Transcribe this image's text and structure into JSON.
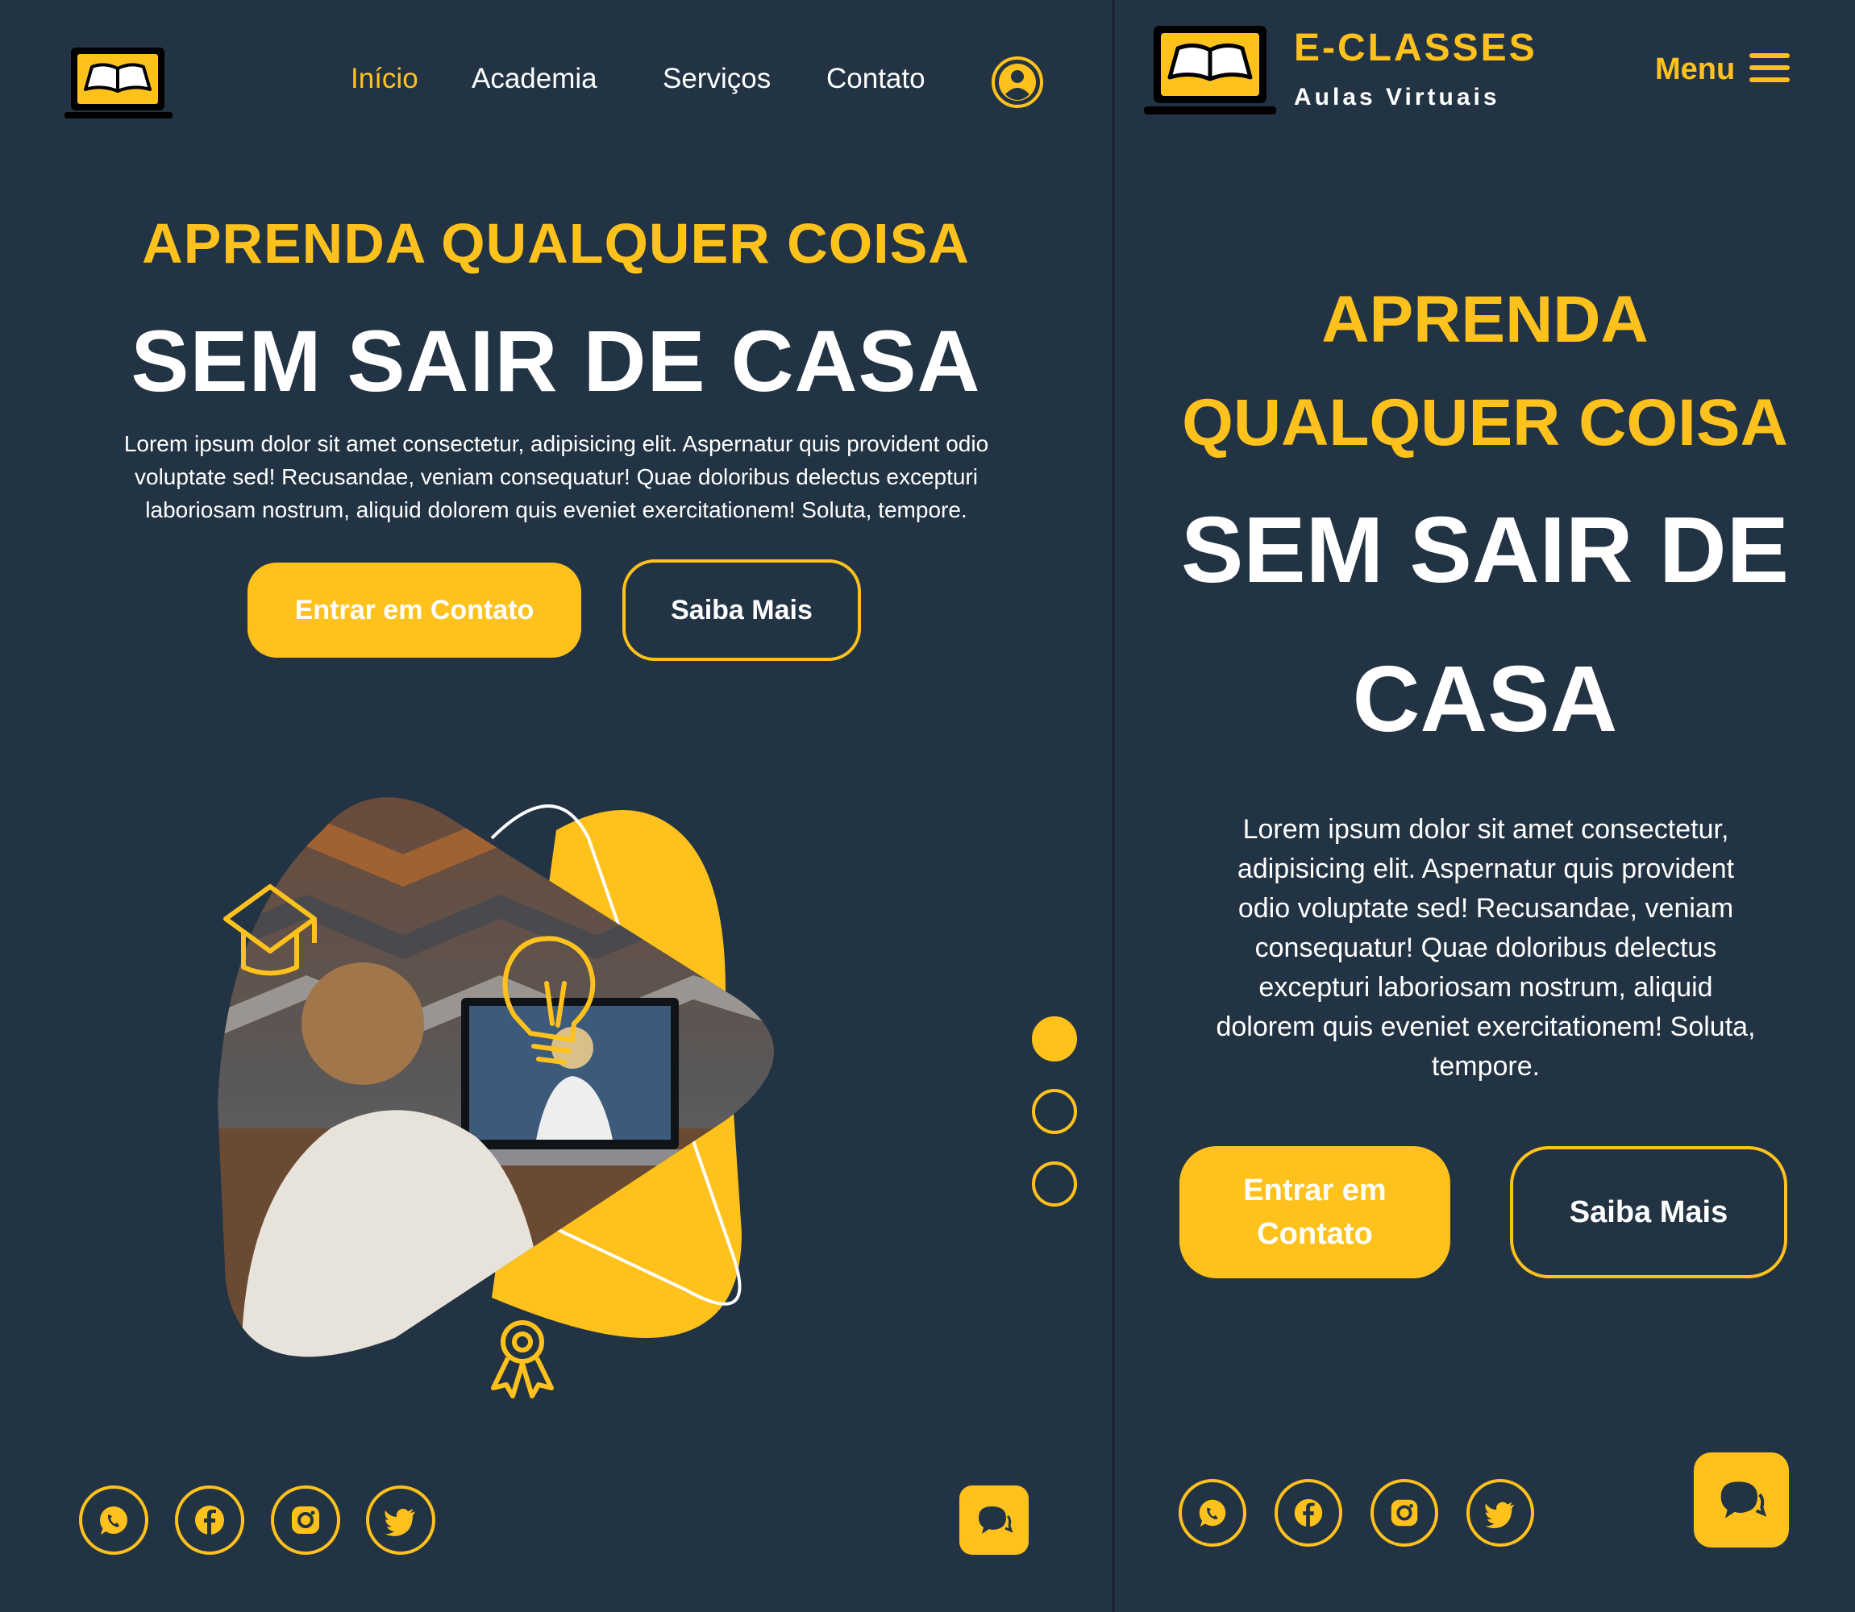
{
  "colors": {
    "background": "#223344",
    "accent": "#FFC21D",
    "text": "#ffffff"
  },
  "desktop": {
    "nav": {
      "logo_icon": "laptop-book-icon",
      "items": [
        {
          "label": "Início",
          "active": true
        },
        {
          "label": "Academia",
          "active": false
        },
        {
          "label": "Serviços",
          "active": false
        },
        {
          "label": "Contato",
          "active": false
        }
      ],
      "account_icon": "user-circle-icon"
    },
    "hero": {
      "line1": "APRENDA QUALQUER COISA",
      "line2": "SEM SAIR DE CASA",
      "paragraph_lines": [
        "Lorem ipsum dolor sit amet consectetur, adipisicing elit. Aspernatur quis provident odio",
        "voluptate sed! Recusandae, veniam consequatur! Quae doloribus delectus excepturi",
        "laboriosam nostrum, aliquid dolorem quis eveniet exercitationem! Soluta, tempore."
      ],
      "primary_button": "Entrar em Contato",
      "secondary_button": "Saiba Mais"
    },
    "illustration": {
      "photo_description_icon": "child-video-class-photo",
      "icons": [
        "graduation-cap-icon",
        "lightbulb-icon",
        "award-badge-icon"
      ]
    },
    "slider": {
      "dots": 3,
      "active_index": 0
    },
    "social": [
      "whatsapp-icon",
      "facebook-icon",
      "instagram-icon",
      "twitter-icon"
    ],
    "chat_icon": "chat-bubble-icon"
  },
  "mobile": {
    "header": {
      "brand": "E-CLASSES",
      "tagline": "Aulas Virtuais",
      "menu_label": "Menu",
      "menu_icon": "hamburger-icon"
    },
    "hero": {
      "h1_lines": [
        "APRENDA",
        "QUALQUER COISA"
      ],
      "h2_lines": [
        "SEM SAIR DE",
        "CASA"
      ],
      "paragraph_lines": [
        "Lorem ipsum dolor sit amet consectetur,",
        "adipisicing elit. Aspernatur quis provident",
        "odio voluptate sed! Recusandae, veniam",
        "consequatur! Quae doloribus delectus",
        "excepturi laboriosam nostrum, aliquid",
        "dolorem quis eveniet exercitationem! Soluta,",
        "tempore."
      ],
      "primary_button_lines": [
        "Entrar em",
        "Contato"
      ],
      "secondary_button": "Saiba Mais"
    },
    "social": [
      "whatsapp-icon",
      "facebook-icon",
      "instagram-icon",
      "twitter-icon"
    ],
    "chat_icon": "chat-bubble-icon"
  }
}
